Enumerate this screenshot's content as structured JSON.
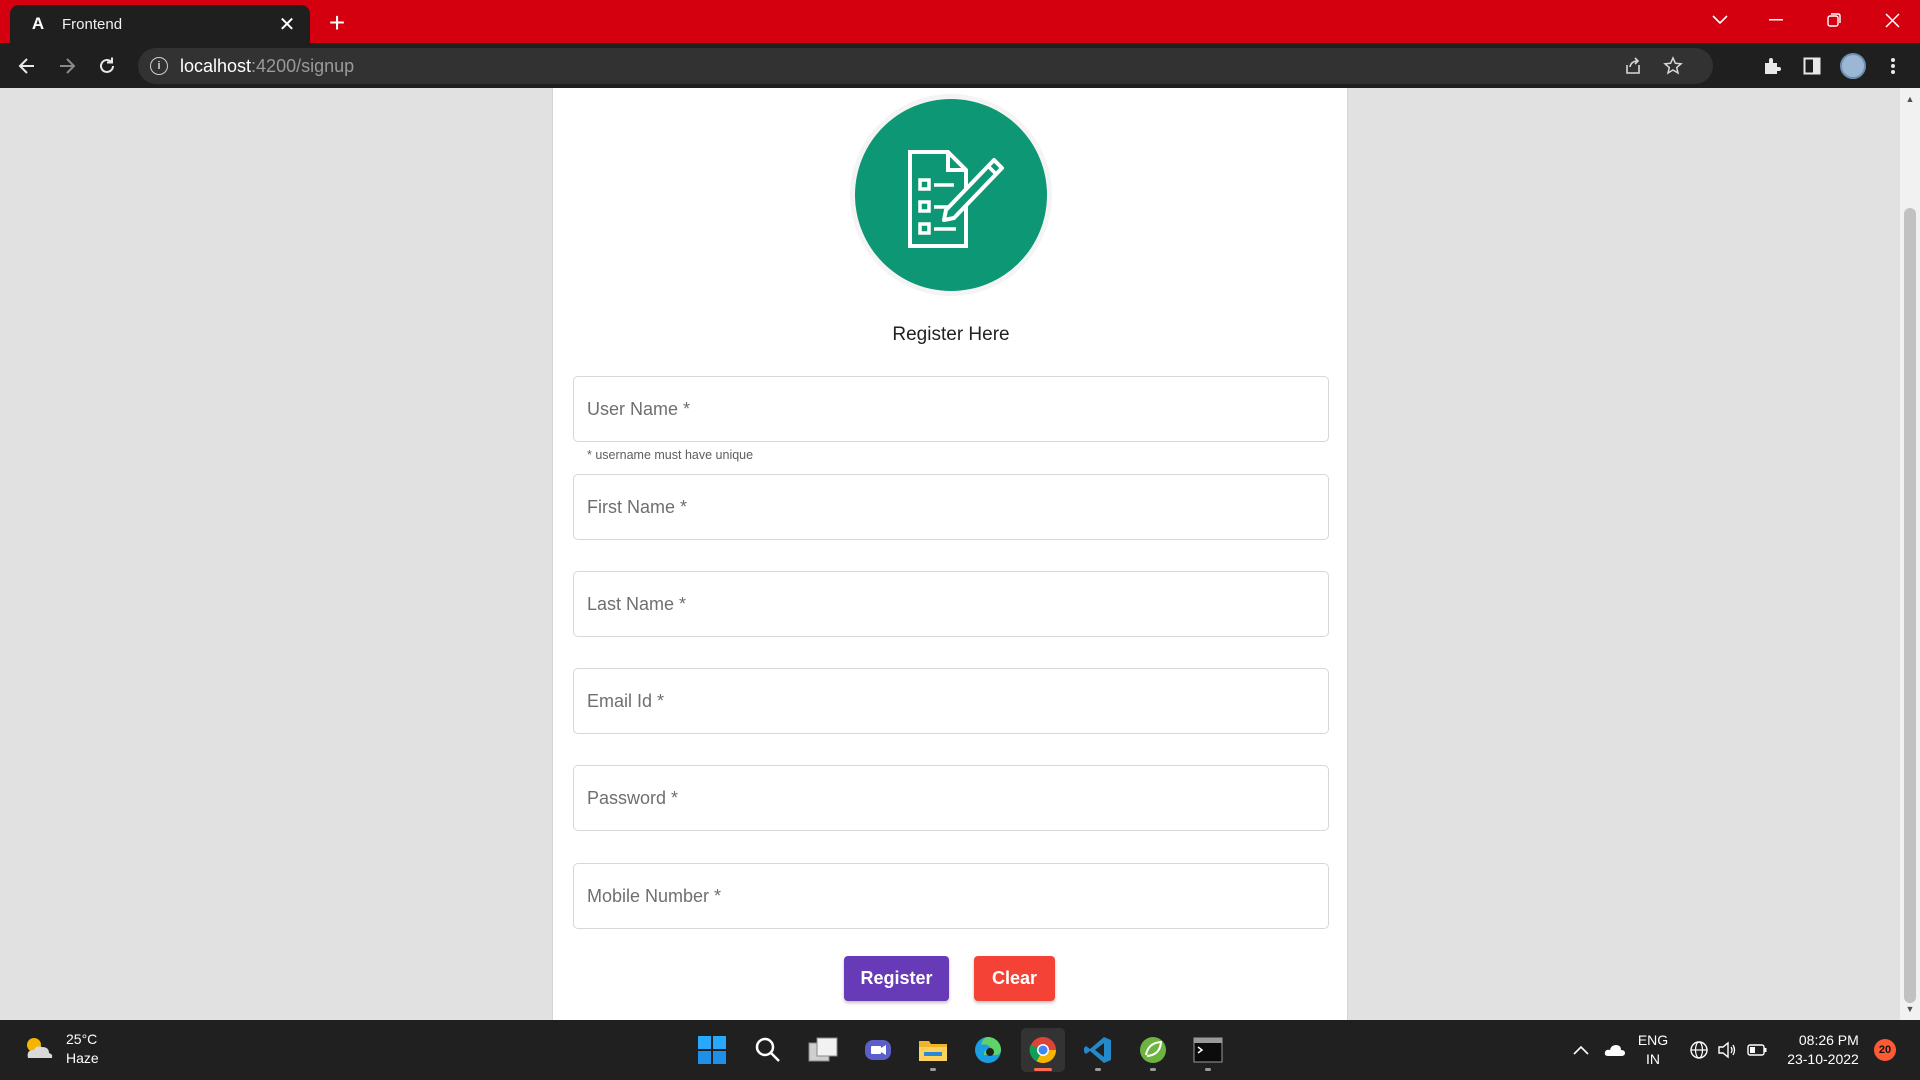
{
  "browser": {
    "tab_title": "Frontend",
    "tab_favicon": "A",
    "url_host": "localhost",
    "url_path": ":4200/signup",
    "accent_color": "#d4000f"
  },
  "page": {
    "form_title": "Register Here",
    "fields": [
      {
        "label": "User Name *"
      },
      {
        "label": "First Name *"
      },
      {
        "label": "Last Name *"
      },
      {
        "label": "Email Id *"
      },
      {
        "label": "Password *"
      },
      {
        "label": "Mobile Number *"
      }
    ],
    "username_hint": "* username must have unique",
    "register_label": "Register",
    "clear_label": "Clear",
    "colors": {
      "register": "#673ab7",
      "clear": "#f44336",
      "logo": "#0e9774"
    }
  },
  "taskbar": {
    "weather_temp": "25°C",
    "weather_desc": "Haze",
    "lang_line1": "ENG",
    "lang_line2": "IN",
    "time": "08:26 PM",
    "date": "23-10-2022",
    "notification_count": "20"
  }
}
